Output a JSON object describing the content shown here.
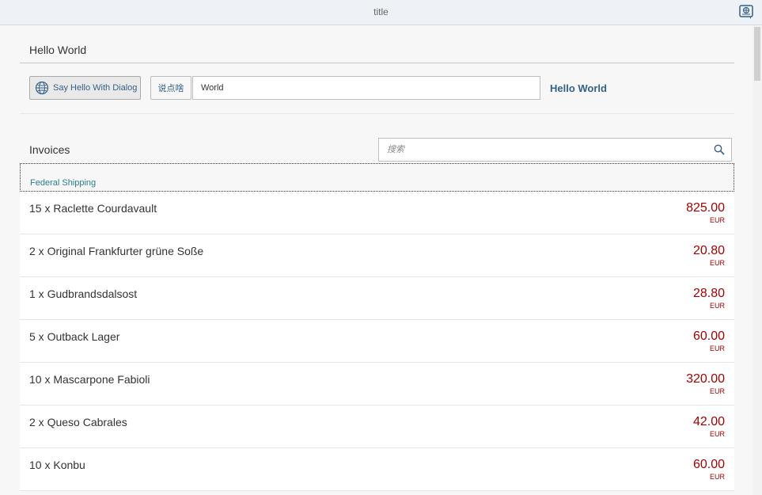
{
  "shell": {
    "title": "title",
    "icon": "shell-info-icon"
  },
  "panel": {
    "title": "Hello World",
    "hello_dialog_button": "Say Hello With Dialog",
    "say_button": "说点啥",
    "name_input_value": "World",
    "hello_text": "Hello World"
  },
  "invoices": {
    "title": "Invoices",
    "search_placeholder": "搜索",
    "group_header": "Federal Shipping",
    "currency_color": "#a50000",
    "items": [
      {
        "description": "15 x Raclette Courdavault",
        "amount": "825.00",
        "currency": "EUR"
      },
      {
        "description": "2 x Original Frankfurter grüne Soße",
        "amount": "20.80",
        "currency": "EUR"
      },
      {
        "description": "1 x Gudbrandsdalsost",
        "amount": "28.80",
        "currency": "EUR"
      },
      {
        "description": "5 x Outback Lager",
        "amount": "60.00",
        "currency": "EUR"
      },
      {
        "description": "10 x Mascarpone Fabioli",
        "amount": "320.00",
        "currency": "EUR"
      },
      {
        "description": "2 x Queso Cabrales",
        "amount": "42.00",
        "currency": "EUR"
      },
      {
        "description": "10 x Konbu",
        "amount": "60.00",
        "currency": "EUR"
      }
    ]
  }
}
